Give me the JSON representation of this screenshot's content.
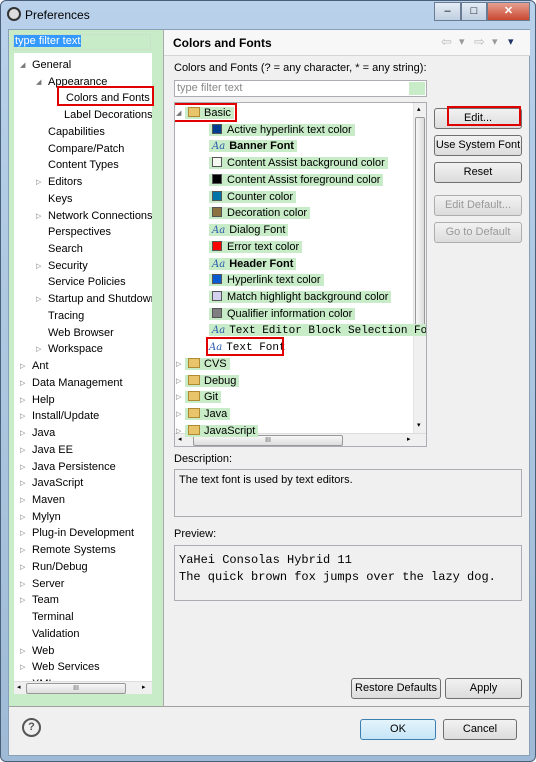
{
  "window": {
    "title": "Preferences",
    "minimize": "–",
    "maximize": "□",
    "close": "✕"
  },
  "left": {
    "filter_value": "type filter text",
    "tree": [
      {
        "label": "General",
        "level": 0,
        "twisty": "open"
      },
      {
        "label": "Appearance",
        "level": 1,
        "twisty": "open"
      },
      {
        "label": "Colors and Fonts",
        "level": 2,
        "twisty": "",
        "selected": true
      },
      {
        "label": "Label Decorations",
        "level": 2,
        "twisty": ""
      },
      {
        "label": "Capabilities",
        "level": 1,
        "twisty": ""
      },
      {
        "label": "Compare/Patch",
        "level": 1,
        "twisty": ""
      },
      {
        "label": "Content Types",
        "level": 1,
        "twisty": ""
      },
      {
        "label": "Editors",
        "level": 1,
        "twisty": "closed"
      },
      {
        "label": "Keys",
        "level": 1,
        "twisty": ""
      },
      {
        "label": "Network Connections",
        "level": 1,
        "twisty": "closed"
      },
      {
        "label": "Perspectives",
        "level": 1,
        "twisty": ""
      },
      {
        "label": "Search",
        "level": 1,
        "twisty": ""
      },
      {
        "label": "Security",
        "level": 1,
        "twisty": "closed"
      },
      {
        "label": "Service Policies",
        "level": 1,
        "twisty": ""
      },
      {
        "label": "Startup and Shutdown",
        "level": 1,
        "twisty": "closed"
      },
      {
        "label": "Tracing",
        "level": 1,
        "twisty": ""
      },
      {
        "label": "Web Browser",
        "level": 1,
        "twisty": ""
      },
      {
        "label": "Workspace",
        "level": 1,
        "twisty": "closed"
      },
      {
        "label": "Ant",
        "level": 0,
        "twisty": "closed"
      },
      {
        "label": "Data Management",
        "level": 0,
        "twisty": "closed"
      },
      {
        "label": "Help",
        "level": 0,
        "twisty": "closed"
      },
      {
        "label": "Install/Update",
        "level": 0,
        "twisty": "closed"
      },
      {
        "label": "Java",
        "level": 0,
        "twisty": "closed"
      },
      {
        "label": "Java EE",
        "level": 0,
        "twisty": "closed"
      },
      {
        "label": "Java Persistence",
        "level": 0,
        "twisty": "closed"
      },
      {
        "label": "JavaScript",
        "level": 0,
        "twisty": "closed"
      },
      {
        "label": "Maven",
        "level": 0,
        "twisty": "closed"
      },
      {
        "label": "Mylyn",
        "level": 0,
        "twisty": "closed"
      },
      {
        "label": "Plug-in Development",
        "level": 0,
        "twisty": "closed"
      },
      {
        "label": "Remote Systems",
        "level": 0,
        "twisty": "closed"
      },
      {
        "label": "Run/Debug",
        "level": 0,
        "twisty": "closed"
      },
      {
        "label": "Server",
        "level": 0,
        "twisty": "closed"
      },
      {
        "label": "Team",
        "level": 0,
        "twisty": "closed"
      },
      {
        "label": "Terminal",
        "level": 0,
        "twisty": ""
      },
      {
        "label": "Validation",
        "level": 0,
        "twisty": ""
      },
      {
        "label": "Web",
        "level": 0,
        "twisty": "closed"
      },
      {
        "label": "Web Services",
        "level": 0,
        "twisty": "closed"
      },
      {
        "label": "XML",
        "level": 0,
        "twisty": "closed"
      }
    ]
  },
  "right": {
    "title": "Colors and Fonts",
    "filter_label": "Colors and Fonts (? = any character, * = any string):",
    "filter_placeholder": "type filter text",
    "tree": [
      {
        "label": "Basic",
        "kind": "folder",
        "twisty": "open",
        "level": 0
      },
      {
        "label": "Active hyperlink text color",
        "kind": "color",
        "color": "#003f8f",
        "level": 1
      },
      {
        "label": "Banner Font",
        "kind": "font",
        "bold": true,
        "level": 1
      },
      {
        "label": "Content Assist background color",
        "kind": "color",
        "color": "#f4f8f0",
        "level": 1
      },
      {
        "label": "Content Assist foreground color",
        "kind": "color",
        "color": "#000000",
        "level": 1
      },
      {
        "label": "Counter color",
        "kind": "color",
        "color": "#0073a8",
        "level": 1
      },
      {
        "label": "Decoration color",
        "kind": "color",
        "color": "#8c7240",
        "level": 1
      },
      {
        "label": "Dialog Font",
        "kind": "font",
        "level": 1
      },
      {
        "label": "Error text color",
        "kind": "color",
        "color": "#ff0000",
        "level": 1
      },
      {
        "label": "Header Font",
        "kind": "font",
        "bold": true,
        "level": 1
      },
      {
        "label": "Hyperlink text color",
        "kind": "color",
        "color": "#0a5bd1",
        "level": 1
      },
      {
        "label": "Match highlight background color",
        "kind": "color",
        "color": "#d4d0f0",
        "level": 1
      },
      {
        "label": "Qualifier information color",
        "kind": "color",
        "color": "#808080",
        "level": 1
      },
      {
        "label": "Text Editor Block Selection Font",
        "kind": "font",
        "mono": true,
        "level": 1
      },
      {
        "label": "Text Font",
        "kind": "font",
        "mono": true,
        "level": 1,
        "plain": true
      },
      {
        "label": "CVS",
        "kind": "folder",
        "twisty": "closed",
        "level": 0
      },
      {
        "label": "Debug",
        "kind": "folder",
        "twisty": "closed",
        "level": 0
      },
      {
        "label": "Git",
        "kind": "folder",
        "twisty": "closed",
        "level": 0
      },
      {
        "label": "Java",
        "kind": "folder",
        "twisty": "closed",
        "level": 0
      },
      {
        "label": "JavaScript",
        "kind": "folder",
        "twisty": "closed",
        "level": 0
      }
    ],
    "buttons": {
      "edit": "Edit...",
      "use_system_font": "Use System Font",
      "reset": "Reset",
      "edit_default": "Edit Default...",
      "go_to_default": "Go to Default"
    },
    "description_label": "Description:",
    "description": "The text font is used by text editors.",
    "preview_label": "Preview:",
    "preview_line1": "YaHei Consolas Hybrid 11",
    "preview_line2": "The quick brown fox jumps over the lazy dog.",
    "restore_defaults": "Restore Defaults",
    "apply": "Apply"
  },
  "footer": {
    "ok": "OK",
    "cancel": "Cancel",
    "help_icon": "?"
  },
  "icons": {
    "nav_back": "⇦",
    "nav_forward": "⇨",
    "dropdown": "▾",
    "scroll_grip": "III"
  },
  "colors": {
    "highlight_green": "#c8ebc8",
    "annotation_red": "#e00000",
    "selection_blue": "#3399ff"
  }
}
